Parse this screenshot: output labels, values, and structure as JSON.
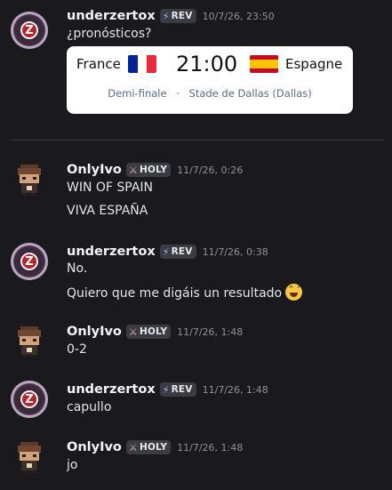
{
  "messages": [
    {
      "author": "underzertox",
      "tag": "REV",
      "tag_icon": "lightning-icon",
      "timestamp": "10/7/26, 23:50",
      "lines": [
        "¿pronósticos?"
      ],
      "card": {
        "home_team": "France",
        "away_team": "Espagne",
        "time": "21:00",
        "stage": "Demi-finale",
        "separator": "·",
        "venue": "Stade de Dallas (Dallas)"
      }
    },
    {
      "author": "OnlyIvo",
      "tag": "HOLY",
      "tag_icon": "sword-icon",
      "timestamp": "11/7/26, 0:26",
      "lines": [
        "WIN OF SPAIN",
        "VIVA ESPAÑA"
      ]
    },
    {
      "author": "underzertox",
      "tag": "REV",
      "tag_icon": "lightning-icon",
      "timestamp": "11/7/26, 0:38",
      "lines": [
        "No.",
        "Quiero que me digáis un resultado"
      ],
      "emoji": "grinning-face-emoji"
    },
    {
      "author": "OnlyIvo",
      "tag": "HOLY",
      "tag_icon": "sword-icon",
      "timestamp": "11/7/26, 1:48",
      "lines": [
        "0-2"
      ]
    },
    {
      "author": "underzertox",
      "tag": "REV",
      "tag_icon": "lightning-icon",
      "timestamp": "11/7/26, 1:48",
      "lines": [
        "capullo"
      ]
    },
    {
      "author": "OnlyIvo",
      "tag": "HOLY",
      "tag_icon": "sword-icon",
      "timestamp": "11/7/26, 1:48",
      "lines": [
        "jo"
      ]
    }
  ],
  "colors": {
    "background": "#1a1a1e",
    "tag_background": "#3a3c43",
    "card_background": "#ffffff",
    "france_flag": [
      "#002395",
      "#ffffff",
      "#ed2939"
    ],
    "spain_flag": [
      "#c60b1e",
      "#ffc400",
      "#c60b1e"
    ]
  }
}
